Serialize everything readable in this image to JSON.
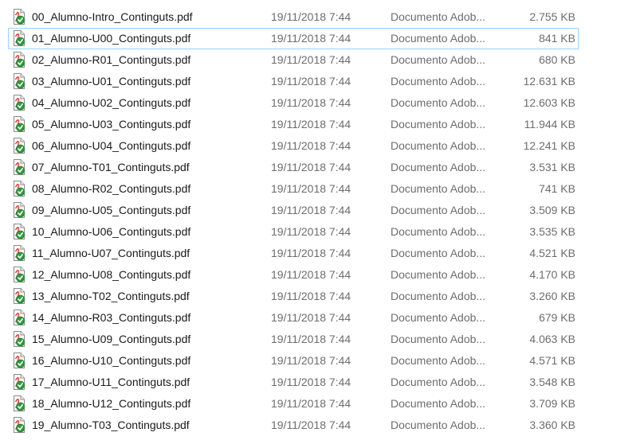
{
  "files": [
    {
      "name": "00_Alumno-Intro_Continguts.pdf",
      "modified": "19/11/2018 7:44",
      "type": "Documento Adob...",
      "size": "2.755 KB",
      "icon": "pdf-file-icon"
    },
    {
      "name": "01_Alumno-U00_Continguts.pdf",
      "modified": "19/11/2018 7:44",
      "type": "Documento Adob...",
      "size": "841 KB",
      "icon": "pdf-file-icon",
      "focused": true
    },
    {
      "name": "02_Alumno-R01_Continguts.pdf",
      "modified": "19/11/2018 7:44",
      "type": "Documento Adob...",
      "size": "680 KB",
      "icon": "pdf-file-icon"
    },
    {
      "name": "03_Alumno-U01_Continguts.pdf",
      "modified": "19/11/2018 7:44",
      "type": "Documento Adob...",
      "size": "12.631 KB",
      "icon": "pdf-file-icon"
    },
    {
      "name": "04_Alumno-U02_Continguts.pdf",
      "modified": "19/11/2018 7:44",
      "type": "Documento Adob...",
      "size": "12.603 KB",
      "icon": "pdf-file-icon"
    },
    {
      "name": "05_Alumno-U03_Continguts.pdf",
      "modified": "19/11/2018 7:44",
      "type": "Documento Adob...",
      "size": "11.944 KB",
      "icon": "pdf-file-icon"
    },
    {
      "name": "06_Alumno-U04_Continguts.pdf",
      "modified": "19/11/2018 7:44",
      "type": "Documento Adob...",
      "size": "12.241 KB",
      "icon": "pdf-file-icon"
    },
    {
      "name": "07_Alumno-T01_Continguts.pdf",
      "modified": "19/11/2018 7:44",
      "type": "Documento Adob...",
      "size": "3.531 KB",
      "icon": "pdf-file-icon"
    },
    {
      "name": "08_Alumno-R02_Continguts.pdf",
      "modified": "19/11/2018 7:44",
      "type": "Documento Adob...",
      "size": "741 KB",
      "icon": "pdf-file-icon"
    },
    {
      "name": "09_Alumno-U05_Continguts.pdf",
      "modified": "19/11/2018 7:44",
      "type": "Documento Adob...",
      "size": "3.509 KB",
      "icon": "pdf-file-icon"
    },
    {
      "name": "10_Alumno-U06_Continguts.pdf",
      "modified": "19/11/2018 7:44",
      "type": "Documento Adob...",
      "size": "3.535 KB",
      "icon": "pdf-file-icon"
    },
    {
      "name": "11_Alumno-U07_Continguts.pdf",
      "modified": "19/11/2018 7:44",
      "type": "Documento Adob...",
      "size": "4.521 KB",
      "icon": "pdf-file-icon"
    },
    {
      "name": "12_Alumno-U08_Continguts.pdf",
      "modified": "19/11/2018 7:44",
      "type": "Documento Adob...",
      "size": "4.170 KB",
      "icon": "pdf-file-icon"
    },
    {
      "name": "13_Alumno-T02_Continguts.pdf",
      "modified": "19/11/2018 7:44",
      "type": "Documento Adob...",
      "size": "3.260 KB",
      "icon": "pdf-file-icon"
    },
    {
      "name": "14_Alumno-R03_Continguts.pdf",
      "modified": "19/11/2018 7:44",
      "type": "Documento Adob...",
      "size": "679 KB",
      "icon": "pdf-file-icon"
    },
    {
      "name": "15_Alumno-U09_Continguts.pdf",
      "modified": "19/11/2018 7:44",
      "type": "Documento Adob...",
      "size": "4.063 KB",
      "icon": "pdf-file-icon"
    },
    {
      "name": "16_Alumno-U10_Continguts.pdf",
      "modified": "19/11/2018 7:44",
      "type": "Documento Adob...",
      "size": "4.571 KB",
      "icon": "pdf-file-icon"
    },
    {
      "name": "17_Alumno-U11_Continguts.pdf",
      "modified": "19/11/2018 7:44",
      "type": "Documento Adob...",
      "size": "3.548 KB",
      "icon": "pdf-file-icon"
    },
    {
      "name": "18_Alumno-U12_Continguts.pdf",
      "modified": "19/11/2018 7:44",
      "type": "Documento Adob...",
      "size": "3.709 KB",
      "icon": "pdf-file-icon"
    },
    {
      "name": "19_Alumno-T03_Continguts.pdf",
      "modified": "19/11/2018 7:44",
      "type": "Documento Adob...",
      "size": "3.360 KB",
      "icon": "pdf-file-icon"
    }
  ],
  "colors": {
    "text_primary": "#1a1a1a",
    "text_secondary": "#6d6d6d",
    "focus_border": "#99d1ff",
    "pdf_red": "#e0261b",
    "check_green": "#2e9b3c"
  }
}
